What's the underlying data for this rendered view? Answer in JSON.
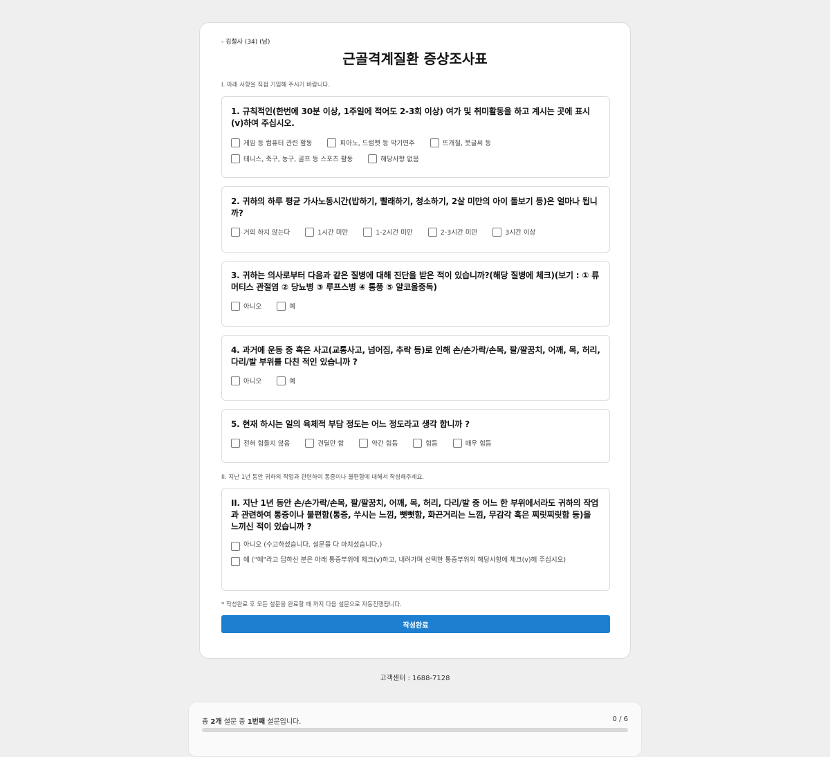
{
  "patient": "- 김철사 (34) (남)",
  "title": "근골격계질환 증상조사표",
  "section1_note": "I. 아래 사항을 직접 기입해 주시기 바랍니다.",
  "questions": [
    {
      "text": "1. 규칙적인(한번에 30분 이상, 1주일에 적어도 2-3회 이상) 여가 및 취미활동을 하고 계시는 곳에 표시(v)하여 주십시오.",
      "options": [
        "게임 등 컴퓨터 관련 활동",
        "피아노, 드럼펫 등 악기연주",
        "뜨개질, 붓글씨 등",
        "테니스, 축구, 농구, 골프 등 스포츠 활동",
        "해당사항 없음"
      ]
    },
    {
      "text": "2. 귀하의 하루 평균 가사노동시간(밥하기, 빨래하기, 청소하기, 2살 미만의 아이 돌보기 등)은 얼마나 됩니까?",
      "options": [
        "거의 하지 않는다",
        "1시간 미만",
        "1-2시간 미만",
        "2-3시간 미만",
        "3시간 이상"
      ]
    },
    {
      "text": "3. 귀하는 의사로부터 다음과 같은 질병에 대해 진단을 받은 적이 있습니까?(해당 질병에 체크)(보기 : ① 류머티스 관절염 ② 당뇨병 ③ 루프스병 ④ 통풍 ⑤ 알코올중독)",
      "options": [
        "아니오",
        "예"
      ]
    },
    {
      "text": "4. 과거에 운동 중 혹은 사고(교통사고, 넘어짐, 추락 등)로 인해 손/손가락/손목, 팔/팔꿈치, 어깨, 목, 허리, 다리/발 부위를 다친 적인 있습니까 ?",
      "options": [
        "아니오",
        "예"
      ]
    },
    {
      "text": "5. 현재 하시는 일의 육체적 부담 정도는 어느 정도라고 생각 합니까 ?",
      "options": [
        "전혀 힘들지 않음",
        "견딜만 함",
        "약간 힘듬",
        "힘듬",
        "매우 힘듬"
      ]
    }
  ],
  "section2_note": "II. 지난 1년 동안 귀하의 작업과 관련하여 통증이나 불편함에 대해서 작성해주세요.",
  "question6": {
    "text": "II. 지난 1년 동안 손/손가락/손목, 팔/팔꿈치, 어깨, 목, 허리, 다리/발 중 어느 한 부위에서라도 귀하의 작업과 관련하여 통증이나 불편함(통증, 쑤시는 느낌, 뻣뻣함, 화끈거리는 느낌, 무감각 혹은 찌릿찌릿함 등)을 느끼신 적이 있습니까 ?",
    "options": [
      "아니오 (수고하셨습니다. 설문을 다 마치셨습니다.)",
      "예 (\"예\"라고 답하신 분은 아래 통증부위에 체크(v)하고, 내려가며 선택한 통증부위의 해당사항에 체크(v)해 주십시오)"
    ]
  },
  "foot_note": "* 작성완료 후 모든 설문을 완료할 때 까지 다음 설문으로 자동진행됩니다.",
  "submit_label": "작성완료",
  "support": "고객센터 : 1688-7128",
  "progress": {
    "prefix": "총 ",
    "total_surveys": "2개",
    "mid": " 설문 중 ",
    "current": "1번째",
    "suffix": " 설문입니다.",
    "count": "0 / 6",
    "fraction": 0,
    "color": "#1e7fd0"
  }
}
